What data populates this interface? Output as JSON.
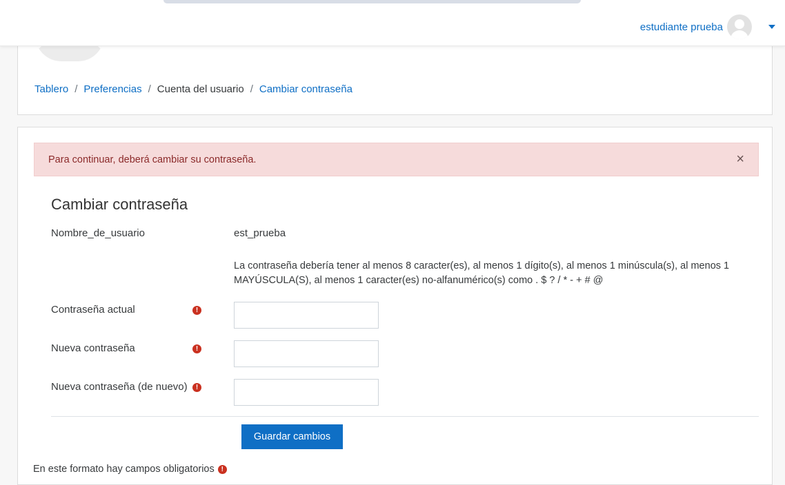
{
  "navbar": {
    "user_name": "estudiante prueba",
    "avatar_icon": "user-avatar-icon",
    "menu_icon": "caret-down-icon"
  },
  "breadcrumb": {
    "items": [
      {
        "label": "Tablero",
        "link": true
      },
      {
        "label": "Preferencias",
        "link": true
      },
      {
        "label": "Cuenta del usuario",
        "link": false
      },
      {
        "label": "Cambiar contraseña",
        "link": true
      }
    ],
    "separator": "/"
  },
  "alert": {
    "message": "Para continuar, deberá cambiar su contraseña.",
    "close": "×"
  },
  "form": {
    "title": "Cambiar contraseña",
    "username_label": "Nombre_de_usuario",
    "username_value": "est_prueba",
    "password_rules": "La contraseña debería tener al menos 8 caracter(es), al menos 1 dígito(s), al menos 1 minúscula(s), al menos 1 MAYÚSCULA(S), al menos 1 caracter(es) no-alfanumérico(s) como . $ ? / * - + # @",
    "current_password_label": "Contraseña actual",
    "new_password_label": "Nueva contraseña",
    "new_password_again_label": "Nueva contraseña (de nuevo)",
    "required_icon": "!",
    "save_label": "Guardar cambios",
    "required_note": "En este formato hay campos obligatorios"
  },
  "colors": {
    "accent": "#0f6fc5",
    "alert_bg": "#f6dbdb",
    "required": "#ca3120"
  }
}
